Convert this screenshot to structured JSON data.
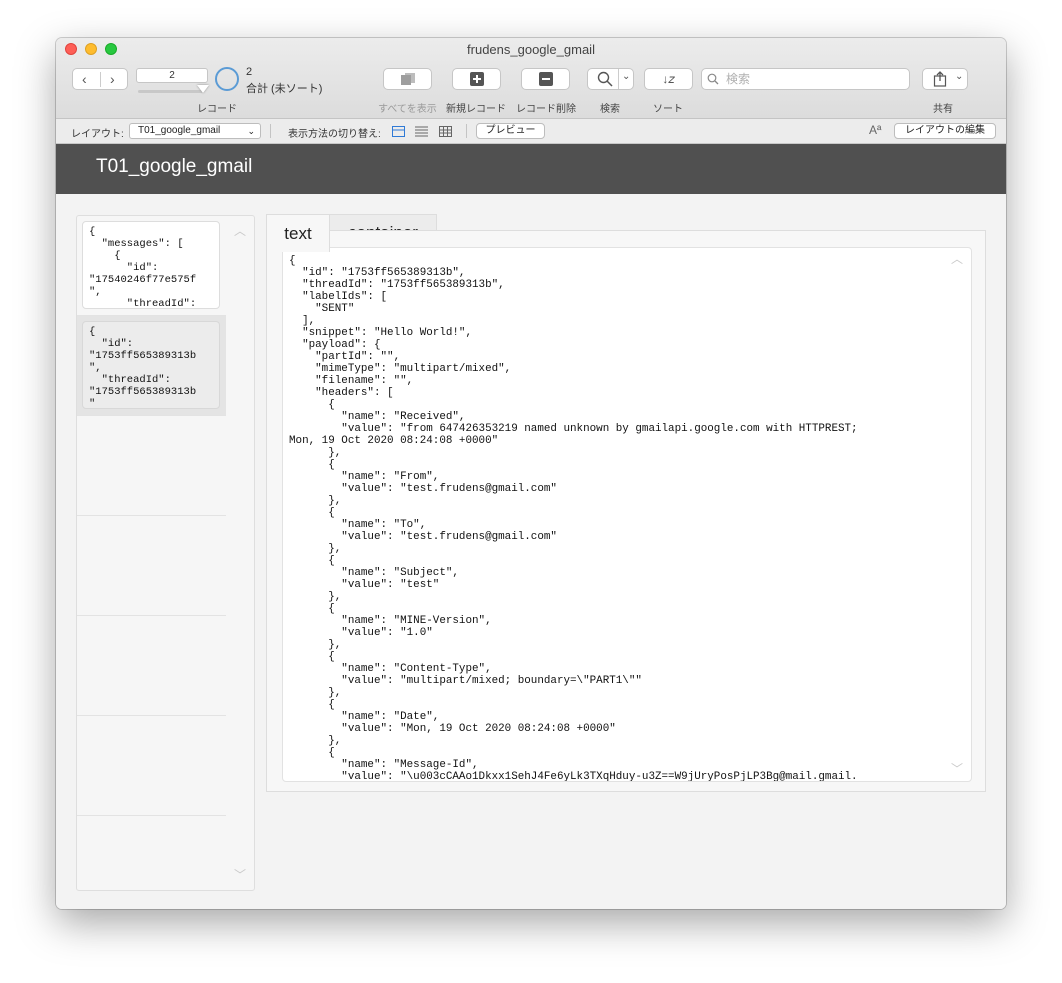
{
  "window": {
    "title": "frudens_google_gmail"
  },
  "toolbar": {
    "record_number": "2",
    "found_count": "2",
    "total_label": "合計 (未ソート)",
    "records_label": "レコード",
    "show_all_label": "すべてを表示",
    "new_record_label": "新規レコード",
    "delete_record_label": "レコード削除",
    "find_label": "検索",
    "sort_label": "ソート",
    "search_placeholder": "検索",
    "share_label": "共有"
  },
  "layout_bar": {
    "layout_label": "レイアウト:",
    "layout_name": "T01_google_gmail",
    "view_as_label": "表示方法の切り替え:",
    "preview_label": "プレビュー",
    "edit_layout_label": "レイアウトの編集",
    "font_icon_text": "Aª"
  },
  "header": {
    "title": "T01_google_gmail"
  },
  "portal": {
    "rows": [
      {
        "text": "{\n  \"messages\": [\n    {\n      \"id\":\n\"17540246f77e575f\n\",\n      \"threadId\":"
      },
      {
        "text": "{\n  \"id\":\n\"1753ff565389313b\n\",\n  \"threadId\":\n\"1753ff565389313b\n\""
      }
    ]
  },
  "tabs": [
    {
      "label": "text"
    },
    {
      "label": "container"
    }
  ],
  "content_text": "{\n  \"id\": \"1753ff565389313b\",\n  \"threadId\": \"1753ff565389313b\",\n  \"labelIds\": [\n    \"SENT\"\n  ],\n  \"snippet\": \"Hello World!\",\n  \"payload\": {\n    \"partId\": \"\",\n    \"mimeType\": \"multipart/mixed\",\n    \"filename\": \"\",\n    \"headers\": [\n      {\n        \"name\": \"Received\",\n        \"value\": \"from 647426353219 named unknown by gmailapi.google.com with HTTPREST;\nMon, 19 Oct 2020 08:24:08 +0000\"\n      },\n      {\n        \"name\": \"From\",\n        \"value\": \"test.frudens@gmail.com\"\n      },\n      {\n        \"name\": \"To\",\n        \"value\": \"test.frudens@gmail.com\"\n      },\n      {\n        \"name\": \"Subject\",\n        \"value\": \"test\"\n      },\n      {\n        \"name\": \"MINE-Version\",\n        \"value\": \"1.0\"\n      },\n      {\n        \"name\": \"Content-Type\",\n        \"value\": \"multipart/mixed; boundary=\\\"PART1\\\"\"\n      },\n      {\n        \"name\": \"Date\",\n        \"value\": \"Mon, 19 Oct 2020 08:24:08 +0000\"\n      },\n      {\n        \"name\": \"Message-Id\",\n        \"value\": \"\\u003cCAAo1Dkxx1SehJ4Fe6yLk3TXqHduy-u3Z==W9jUryPosPjLP3Bg@mail.gmail."
}
